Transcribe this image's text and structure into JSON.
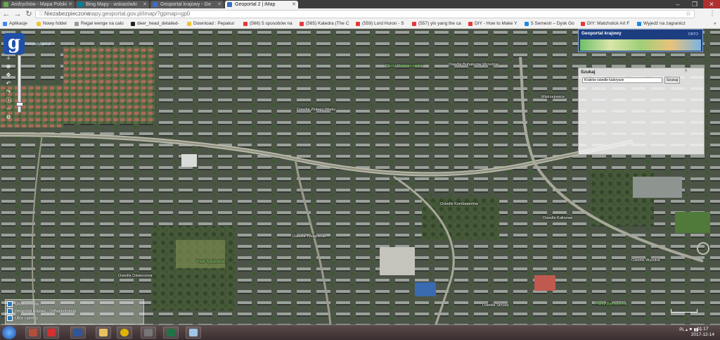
{
  "browser": {
    "tabs": [
      {
        "title": "Andrychów - Mapa Polski",
        "color": "#6aa84f"
      },
      {
        "title": "Bing Mapy - wskazówki",
        "color": "#00809d"
      },
      {
        "title": "Geoportal krajowy - Ge",
        "color": "#3c6dc5"
      },
      {
        "title": "Geoportal 2 | iMap",
        "color": "#3c6dc5"
      }
    ],
    "address": {
      "security": "Niezabezpieczona",
      "url": "mapy.geoportal.gov.pl/imap/?gpmap=gp0"
    },
    "bookmarks": [
      {
        "label": "Aplikacje",
        "color": "#4285f4"
      },
      {
        "label": "Nowy folder",
        "color": "#f1c232"
      },
      {
        "label": "Regał wenge na calo",
        "color": "#999999"
      },
      {
        "label": "deer_head_detailed-",
        "color": "#222222"
      },
      {
        "label": "Download : Pepakur",
        "color": "#f1c232"
      },
      {
        "label": "(566) 5 sposobów na",
        "color": "#e53935"
      },
      {
        "label": "(565) Katedra (The C",
        "color": "#e53935"
      },
      {
        "label": "(559) Lord Huron - S",
        "color": "#e53935"
      },
      {
        "label": "(557) yin yang the ca",
        "color": "#e53935"
      },
      {
        "label": "DIY - How to Make Y",
        "color": "#e53935"
      },
      {
        "label": "5 Semestr – Dysk Go",
        "color": "#1e88e5"
      },
      {
        "label": "DIY: Matchstick Art F",
        "color": "#e53935"
      },
      {
        "label": "Wyjedź na zagranicz",
        "color": "#1e88e5"
      }
    ]
  },
  "map": {
    "logo_letter": "g",
    "logo_caption": "Geoportal.gov.pl",
    "geoportal_panel": {
      "title": "Geoportal krajowy",
      "subtitle": "ORTO"
    },
    "search": {
      "title": "Szukaj",
      "help": "?",
      "value": "Kraków osiedle kalorysze",
      "button": "Szukaj"
    },
    "labels": [
      {
        "text": "Planty Mistrzejowickie",
        "tone": "green"
      },
      {
        "text": "Osiedle Bohaterów Września",
        "tone": "white"
      },
      {
        "text": "Mistrzejowice",
        "tone": "white"
      },
      {
        "text": "Osiedle Złotego Wieku",
        "tone": "white"
      },
      {
        "text": "Osiedle Kombatantów",
        "tone": "white"
      },
      {
        "text": "Osiedle Kalinowe",
        "tone": "white"
      },
      {
        "text": "Osiedle Tysiąclecia",
        "tone": "white"
      },
      {
        "text": "Park Tysiąclecia",
        "tone": "green"
      },
      {
        "text": "Osiedle Oświecenia",
        "tone": "white"
      },
      {
        "text": "Osiedle Wysokie",
        "tone": "white"
      },
      {
        "text": "Osiedle Strusia",
        "tone": "white"
      },
      {
        "text": "Planty Bieńczyckie",
        "tone": "green"
      }
    ],
    "layers": [
      {
        "label": "Ortofotomapa"
      },
      {
        "label": "Geoportal krajowy - Orthophotomap"
      },
      {
        "label": "Ulice i adresy"
      }
    ]
  },
  "taskbar": {
    "tray_lang": "PL",
    "time": "01:17",
    "date": "2017-12-14",
    "apps": [
      {
        "name": "photo",
        "color": "#b0503a"
      },
      {
        "name": "autocad",
        "color": "#d32f2f"
      },
      {
        "name": "word",
        "color": "#2b579a"
      },
      {
        "name": "explorer",
        "color": "#e8c060"
      },
      {
        "name": "chrome",
        "color": "#e0b400"
      },
      {
        "name": "car",
        "color": "#777777"
      },
      {
        "name": "excel",
        "color": "#217346"
      },
      {
        "name": "paint",
        "color": "#9fc5e8"
      }
    ]
  }
}
